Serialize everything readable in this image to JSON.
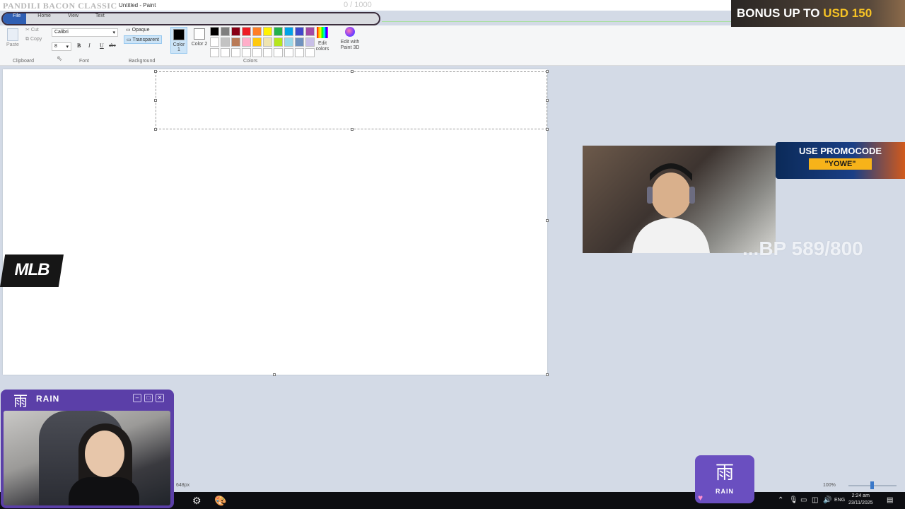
{
  "window": {
    "title": "Untitled - Paint",
    "overlay_text": "PANDILI BACON CLASSIC",
    "goal_progress": "0 / 1000"
  },
  "menu": {
    "tabs": [
      "File",
      "Home",
      "View",
      "Text"
    ]
  },
  "ribbon": {
    "clipboard": {
      "label": "Clipboard",
      "paste": "Paste",
      "cut": "Cut",
      "copy": "Copy"
    },
    "font": {
      "label": "Font",
      "family": "Calibri",
      "size": "8",
      "bold": "B",
      "italic": "I",
      "underline": "U",
      "strike": "abc"
    },
    "background": {
      "label": "Background",
      "opaque": "Opaque",
      "transparent": "Transparent"
    },
    "colors": {
      "label": "Colors",
      "color1": "Color 1",
      "color2": "Color 2",
      "edit_colors": "Edit colors",
      "edit_paint3d": "Edit with Paint 3D",
      "color1_value": "#000000",
      "color2_value": "#ffffff",
      "palette_row1": [
        "#000000",
        "#7f7f7f",
        "#880015",
        "#ed1c24",
        "#ff7f27",
        "#fff200",
        "#22b14c",
        "#00a2e8",
        "#3f48cc",
        "#a349a4"
      ],
      "palette_row2": [
        "#ffffff",
        "#c3c3c3",
        "#b97a57",
        "#ffaec9",
        "#ffc90e",
        "#efe4b0",
        "#b5e61d",
        "#99d9ea",
        "#7092be",
        "#c8bfe7"
      ],
      "palette_row3": [
        "#ffffff",
        "#ffffff",
        "#ffffff",
        "#ffffff",
        "#ffffff",
        "#ffffff",
        "#ffffff",
        "#ffffff",
        "#ffffff",
        "#ffffff"
      ]
    }
  },
  "status": {
    "dimension": "648px",
    "zoom": "100%"
  },
  "taskbar": {
    "lang": "ENG",
    "time": "2:24 am",
    "date": "23/11/2025"
  },
  "overlays": {
    "bonus_prefix": "BONUS UP TO",
    "bonus_amount": "USD 150",
    "promo_line": "USE PROMOCODE",
    "promo_code": "\"YOWE\"",
    "bp_progress": "...BP 589/800",
    "mlb_logo": "MLB",
    "rain_glyph": "雨",
    "rain_word": "RAIN"
  }
}
